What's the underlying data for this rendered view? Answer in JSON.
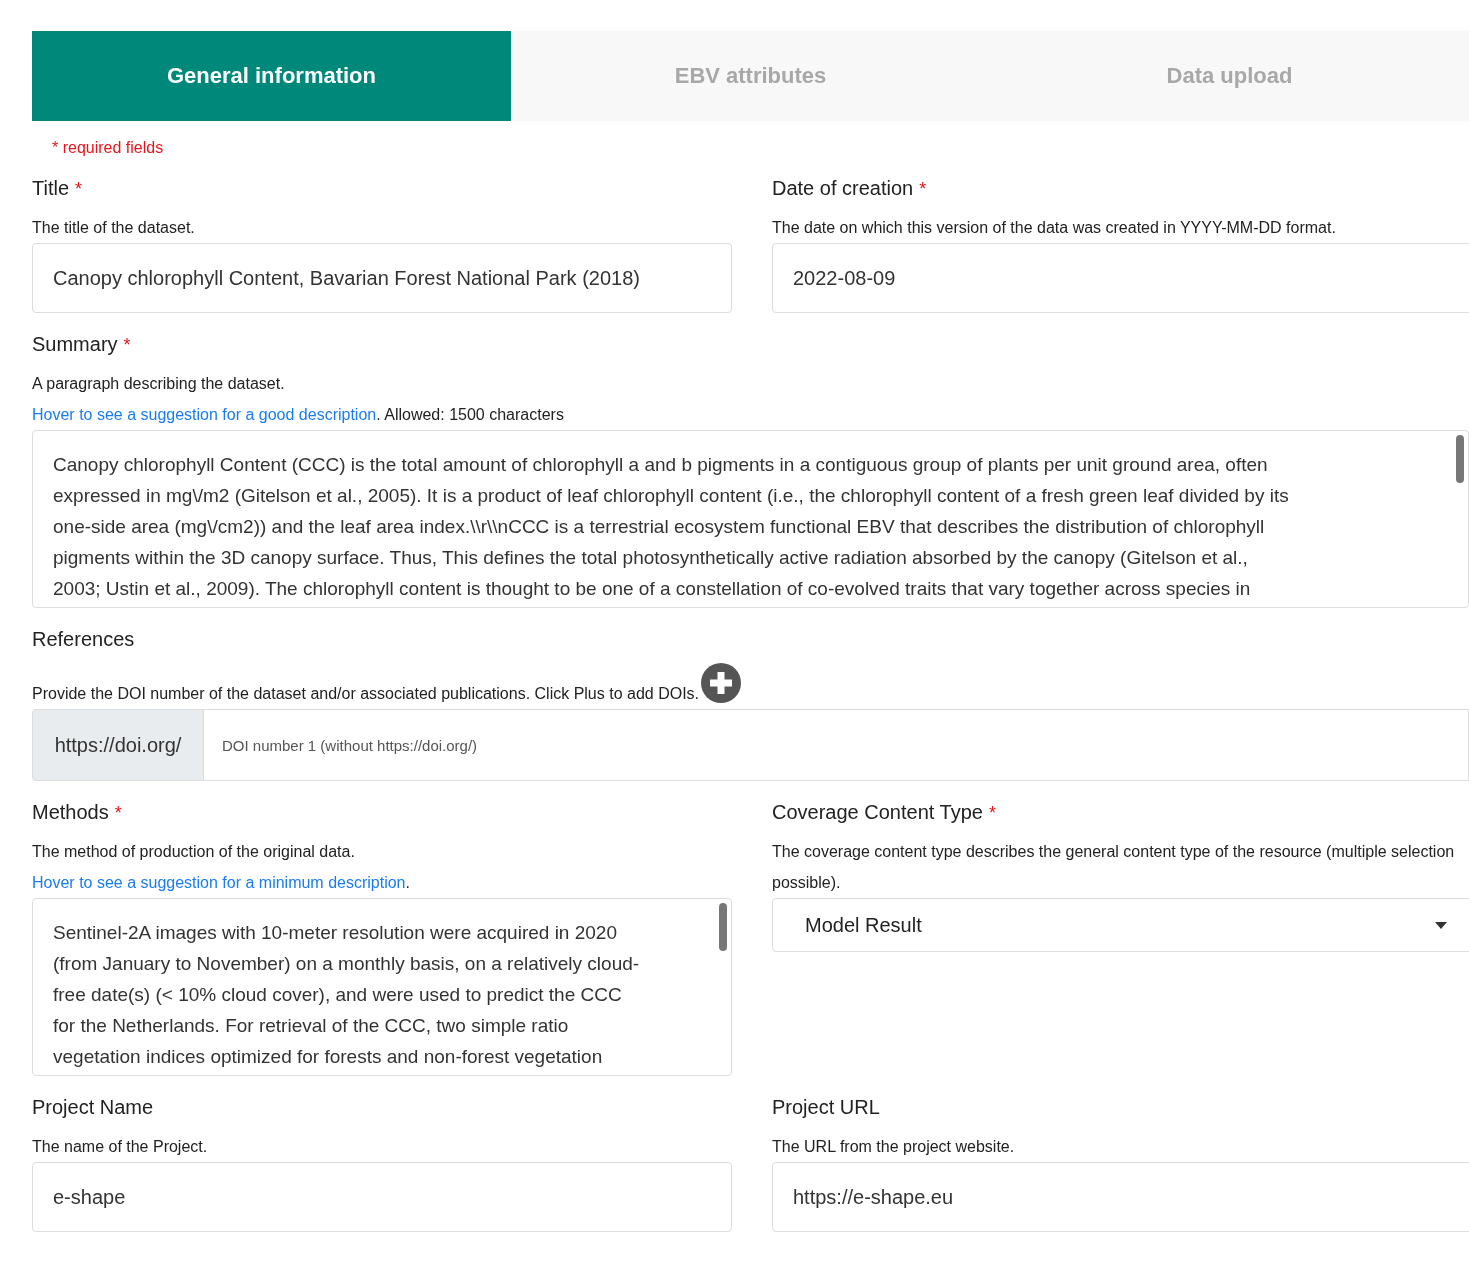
{
  "tabs": [
    {
      "label": "General information",
      "selected": true
    },
    {
      "label": "EBV attributes",
      "selected": false
    },
    {
      "label": "Data upload",
      "selected": false
    }
  ],
  "required_note": "* required fields",
  "rows": [
    [
      {
        "kind": "input",
        "label": "Title",
        "required_mark": "*",
        "description": "The title of the dataset.",
        "value": "Canopy chlorophyll Content, Bavarian Forest National Park (2018)"
      },
      {
        "kind": "input",
        "label": "Date of creation",
        "required_mark": "*",
        "description": "The date on which this version of the data was created in YYYY-MM-DD format.",
        "value": "2022-08-09"
      }
    ],
    [
      {
        "kind": "textarea",
        "label": "Summary",
        "required_mark": "*",
        "description": "A paragraph describing the dataset.",
        "hint_link": "Hover to see a suggestion for a good description",
        "hint_text": ". Allowed: 1500 characters",
        "lines": [
          "Canopy chlorophyll Content (CCC) is the total amount of chlorophyll a and b pigments in a contiguous group of plants per unit ground area, often",
          "expressed in mg\\/m2 (Gitelson et al., 2005). It is a product of leaf chlorophyll content (i.e., the chlorophyll content of a fresh green leaf divided by its",
          "one-side area (mg\\/cm2)) and the leaf area index.\\\\r\\\\nCCC is a terrestrial ecosystem functional EBV that describes the distribution of chlorophyll",
          "pigments within the 3D canopy surface. Thus, This defines the total photosynthetically active radiation absorbed by the canopy (Gitelson et al.,",
          "2003; Ustin et al., 2009). The chlorophyll content is thought to be one of a constellation of co-evolved traits that vary together across species in"
        ]
      }
    ],
    [
      {
        "kind": "doi",
        "label": "References",
        "description": "Provide the DOI number of the dataset and/or associated publications. Click Plus to add DOIs.",
        "prefix": "https://doi.org/",
        "placeholder": "DOI number 1 (without https://doi.org/)"
      }
    ],
    [
      {
        "kind": "textarea",
        "label": "Methods",
        "required_mark": "*",
        "description": "The method of production of the original data.",
        "hint_link": "Hover to see a suggestion for a minimum description",
        "hint_text": ".",
        "lines": [
          "Sentinel-2A images with 10-meter resolution were acquired in 2020",
          "(from January to November) on a monthly basis, on a relatively cloud-",
          "free date(s) (< 10% cloud cover), and were used to predict the CCC",
          "for the Netherlands. For retrieval of the CCC, two simple ratio",
          "vegetation indices optimized for forests and non-forest vegetation"
        ]
      },
      {
        "kind": "select",
        "label": "Coverage Content Type",
        "required_mark": "*",
        "description": "The coverage content type describes the general content type of the resource (multiple selection possible).",
        "value": "Model Result"
      }
    ],
    [
      {
        "kind": "input",
        "label": "Project Name",
        "description": "The name of the Project.",
        "value": "e-shape"
      },
      {
        "kind": "input",
        "label": "Project URL",
        "description": "The URL from the project website.",
        "value": "https://e-shape.eu"
      }
    ]
  ]
}
